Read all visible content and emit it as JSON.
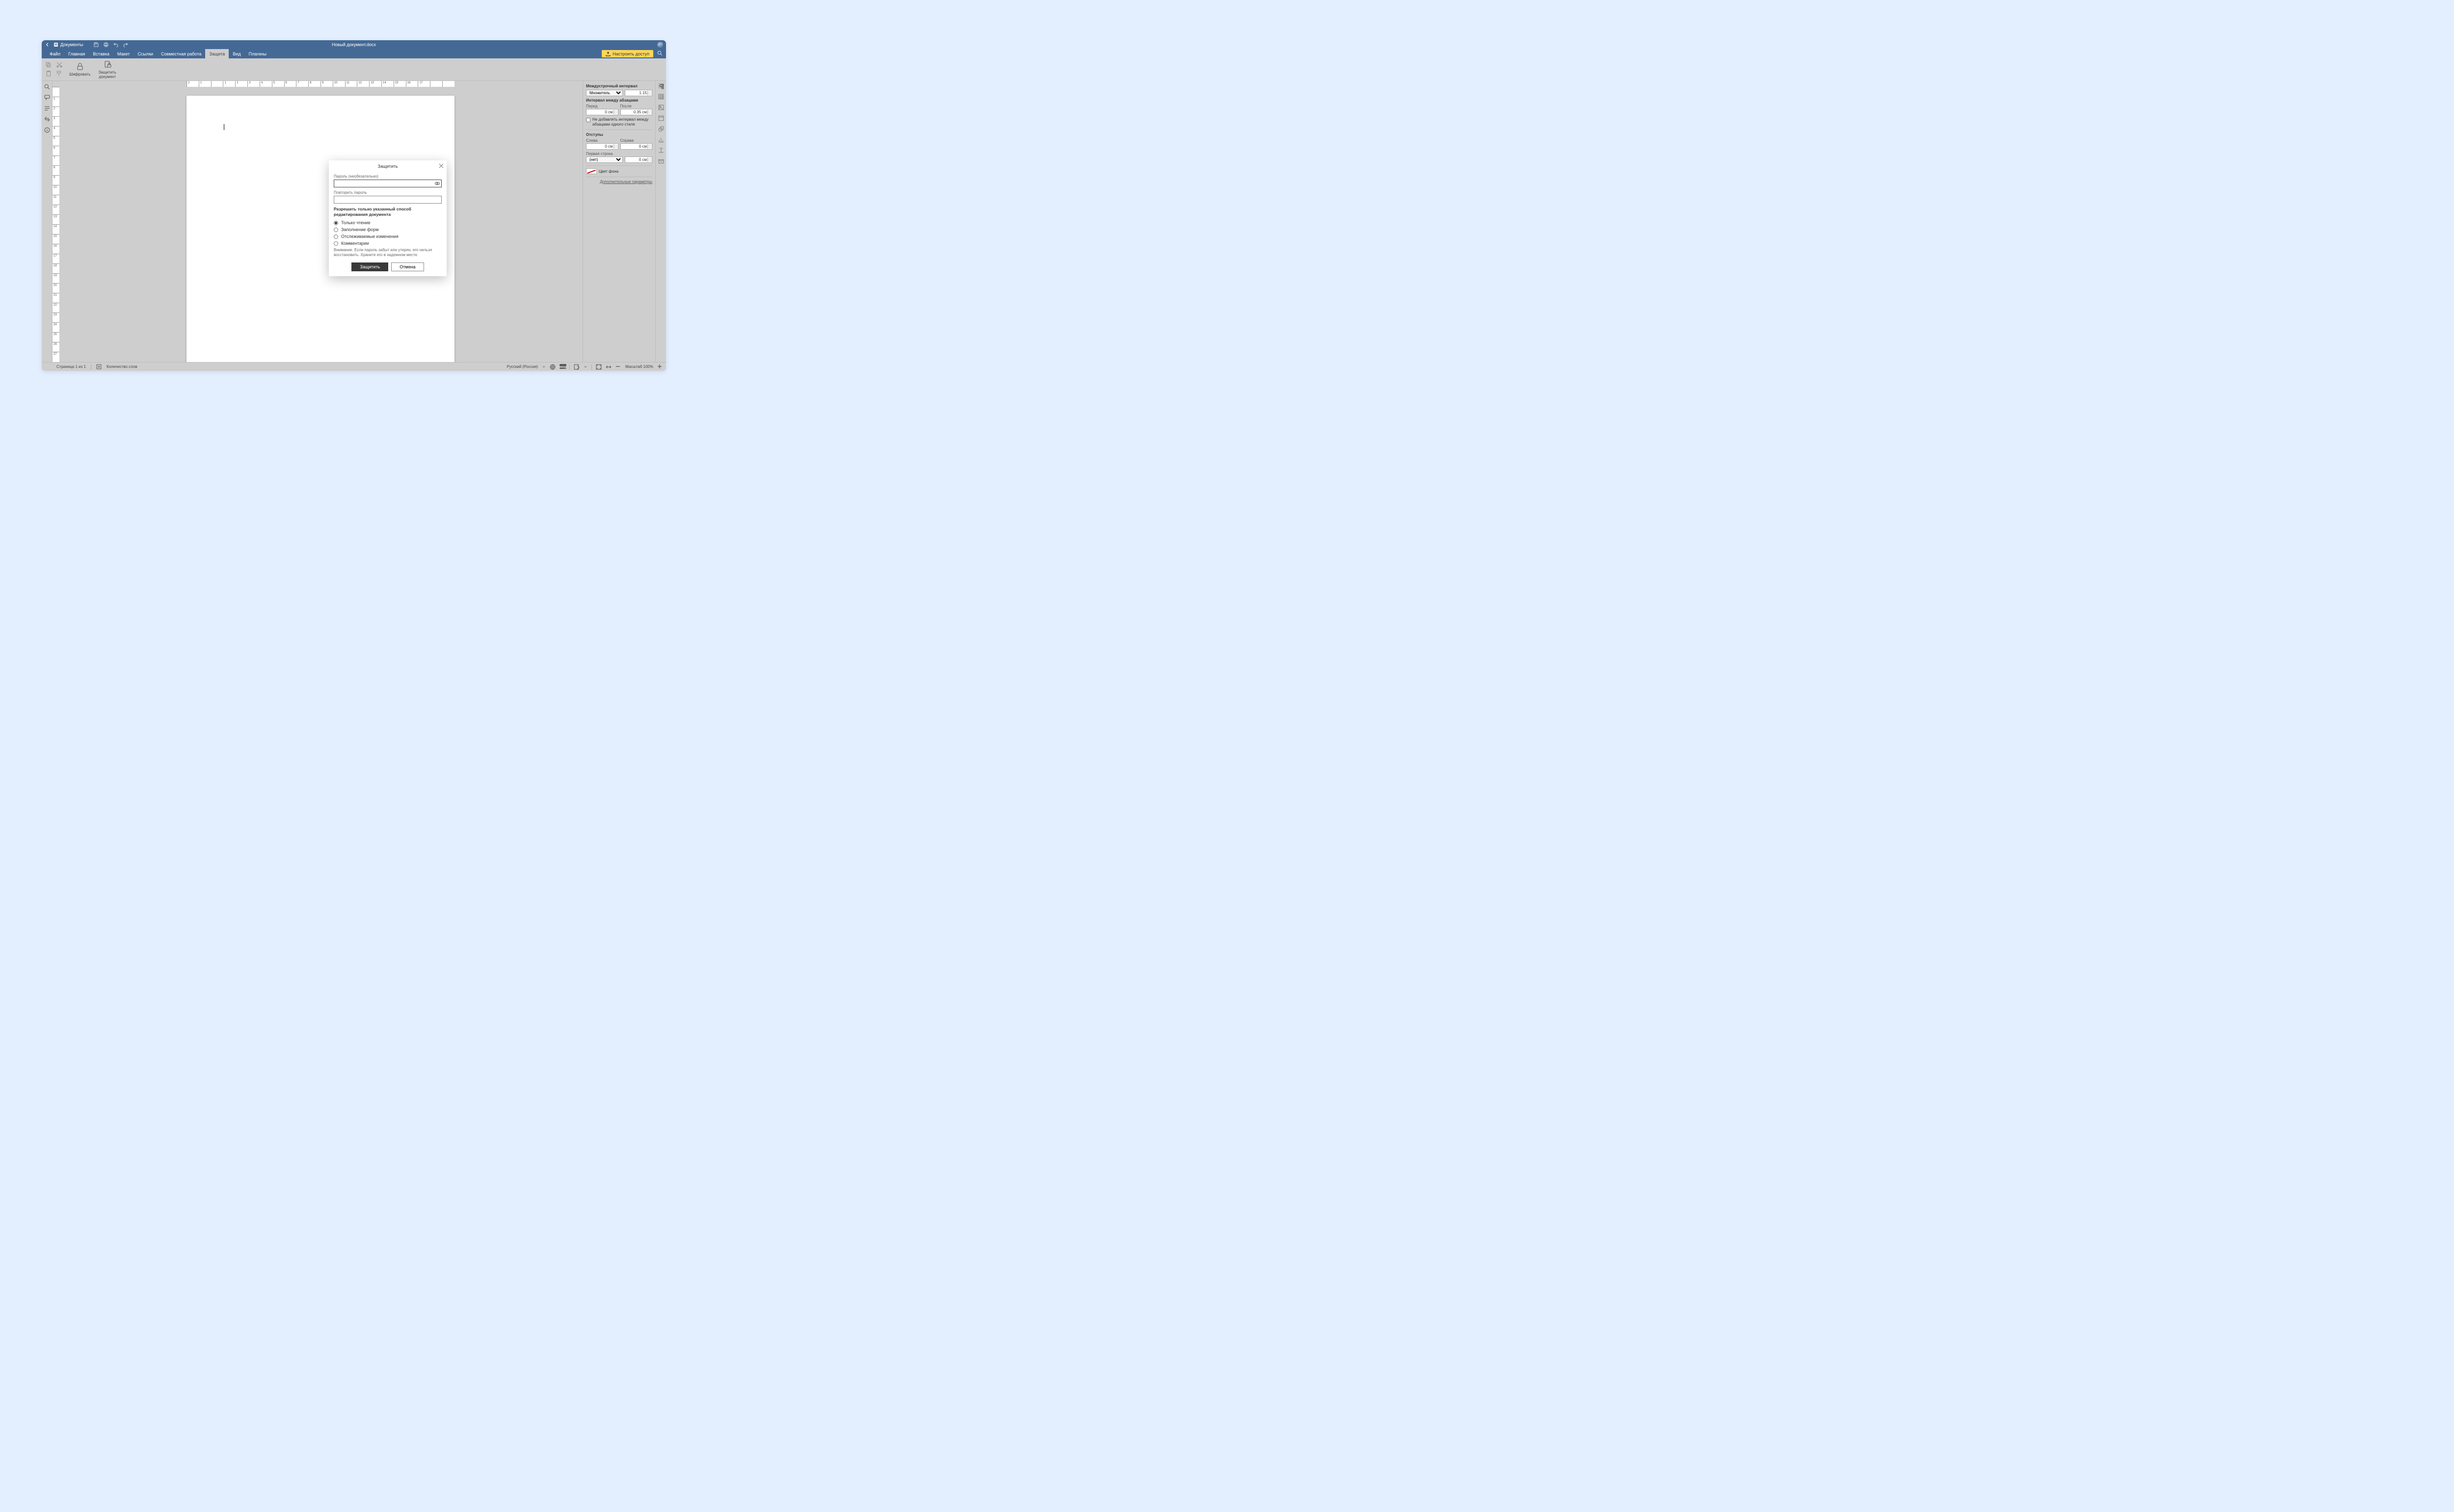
{
  "app": {
    "name": "Документы",
    "avatar_initials": "ДП"
  },
  "title_bar": {
    "doc_title": "Новый документ.docx"
  },
  "menu": {
    "file": "Файл",
    "home": "Главная",
    "insert": "Вставка",
    "layout": "Макет",
    "references": "Ссылки",
    "collaboration": "Совместная работа",
    "protect": "Защита",
    "view": "Вид",
    "plugins": "Плагины",
    "access_button": "Настроить доступ"
  },
  "ribbon": {
    "encrypt": "Шифровать",
    "protect_doc": "Защитить\nдокумент"
  },
  "right_panel": {
    "line_spacing_title": "Междустрочный интервал",
    "line_spacing_mode": "Множитель",
    "line_spacing_value": "1.15",
    "para_spacing_title": "Интервал между абзацами",
    "before_label": "Перед",
    "after_label": "После",
    "before_value": "0 см",
    "after_value": "0.35 см",
    "dont_add_same_style": "Не добавлять интервал между абзацами одного стиля",
    "indents_title": "Отступы",
    "left_label": "Слева",
    "right_label": "Справа",
    "left_value": "0 см",
    "right_value": "0 см",
    "first_line_title": "Первая строка",
    "first_line_mode": "(нет)",
    "first_line_value": "0 см",
    "bg_color_label": "Цвет фона",
    "advanced_link": "Дополнительные параметры"
  },
  "status": {
    "page_info": "Страница 1 из 1",
    "word_count": "Количество слов",
    "language": "Русский (Россия)",
    "zoom": "Масштаб 100%"
  },
  "modal": {
    "title": "Защитить",
    "password_label": "Пароль (необязательно)",
    "repeat_label": "Повторить пароль",
    "section": "Разрешить только указанный способ редактирования документа",
    "opt_readonly": "Только чтение",
    "opt_forms": "Заполнение форм",
    "opt_tracked": "Отслеживаемые изменения",
    "opt_comments": "Комментарии",
    "warning": "Внимание. Если пароль забыт или утерян, его нельзя восстановить. Храните его в надежном месте.",
    "protect_btn": "Защитить",
    "cancel_btn": "Отмена"
  },
  "h_ruler_ticks": [
    "2",
    "1",
    "",
    "1",
    "2",
    "3",
    "4",
    "5",
    "6",
    "7",
    "8",
    "9",
    "10",
    "11",
    "12",
    "13",
    "14",
    "15",
    "16",
    "17",
    "",
    ""
  ],
  "v_ruler_ticks": [
    "",
    "1",
    "2",
    "3",
    "4",
    "5",
    "6",
    "7",
    "8",
    "9",
    "10",
    "11",
    "12",
    "13",
    "14",
    "15",
    "16",
    "17",
    "18",
    "19",
    "20",
    "21",
    "22",
    "23",
    "24",
    "25",
    "26",
    "27"
  ]
}
